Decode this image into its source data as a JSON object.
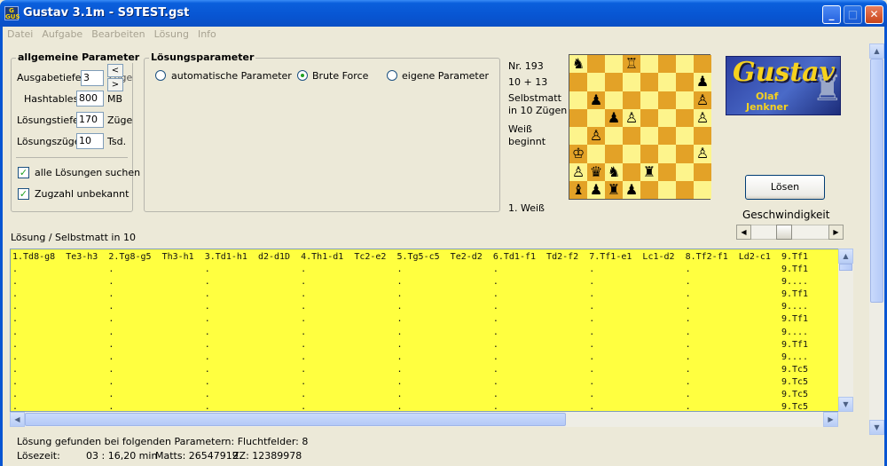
{
  "window": {
    "app_icon_text": "G\nGUS",
    "title": "Gustav 3.1m - S9TEST.gst",
    "minimize": "_",
    "maximize": "□",
    "close": "✕"
  },
  "menu": [
    "Datei",
    "Aufgabe",
    "Bearbeiten",
    "Lösung",
    "Info"
  ],
  "general_params": {
    "title": "allgemeine Parameter",
    "output_depth_label": "Ausgabetiefe",
    "output_depth_value": "3",
    "output_depth_unit": "Züge",
    "hashtables_label": "Hashtables",
    "hashtables_value": "800",
    "hashtables_unit": "MB",
    "solution_depth_label": "Lösungstiefe",
    "solution_depth_value": "170",
    "solution_depth_unit": "Züge",
    "solution_moves_label": "Lösungszüge",
    "solution_moves_value": "10",
    "solution_moves_unit": "Tsd.",
    "all_solutions_label": "alle Lösungen suchen",
    "all_solutions_checked": true,
    "count_unknown_label": "Zugzahl unbekannt",
    "count_unknown_checked": true,
    "spin_left": "<",
    "spin_right": ">"
  },
  "solution_params": {
    "title": "Lösungsparameter",
    "options": [
      {
        "label": "automatische Parameter",
        "selected": false
      },
      {
        "label": "Brute Force",
        "selected": true
      },
      {
        "label": "eigene Parameter",
        "selected": false
      }
    ]
  },
  "problem": {
    "number": "Nr. 193",
    "pieces": "10 + 13",
    "stipulation_line1": "Selbstmatt",
    "stipulation_line2": "in 10 Zügen",
    "to_move_line1": "Weiß",
    "to_move_line2": "beginnt",
    "current_move": "1. Weiß"
  },
  "board": [
    [
      "♞",
      "",
      "",
      "♖",
      "",
      "",
      "",
      ""
    ],
    [
      "",
      "",
      "",
      "",
      "",
      "",
      "",
      "♟"
    ],
    [
      "",
      "♟",
      "",
      "",
      "",
      "",
      "",
      "♙"
    ],
    [
      "",
      "",
      "♟",
      "♙",
      "",
      "",
      "",
      "♙"
    ],
    [
      "",
      "♙",
      "",
      "",
      "",
      "",
      "",
      ""
    ],
    [
      "♔",
      "",
      "",
      "",
      "",
      "",
      "",
      "♙"
    ],
    [
      "♙",
      "♛",
      "♞",
      "",
      "♜",
      "",
      "",
      ""
    ],
    [
      "♝",
      "♟",
      "♜",
      "♟",
      "",
      "",
      "",
      ""
    ],
    [
      "♛",
      "♕",
      "♚",
      "♖",
      "",
      "",
      "",
      ""
    ]
  ],
  "logo": {
    "title": "Gustav",
    "author_line1": "Olaf",
    "author_line2": "Jenkner",
    "castle_icon": "♜"
  },
  "solve_button": "Lösen",
  "speed_label": "Geschwindigkeit",
  "solution_caption": "Lösung / Selbstmatt in 10",
  "solution_lines": [
    "1.Td8-g8  Te3-h3  2.Tg8-g5  Th3-h1  3.Td1-h1  d2-d1D  4.Th1-d1  Tc2-e2  5.Tg5-c5  Te2-d2  6.Td1-f1  Td2-f2  7.Tf1-e1  Lc1-d2  8.Tf2-f1  Ld2-c1  9.Tf1",
    ".                 .                 .                 .                 .                 .                 .                 .                 9.Tf1",
    ".                 .                 .                 .                 .                 .                 .                 .                 9....",
    ".                 .                 .                 .                 .                 .                 .                 .                 9.Tf1",
    ".                 .                 .                 .                 .                 .                 .                 .                 9....",
    ".                 .                 .                 .                 .                 .                 .                 .                 9.Tf1",
    ".                 .                 .                 .                 .                 .                 .                 .                 9....",
    ".                 .                 .                 .                 .                 .                 .                 .                 9.Tf1",
    ".                 .                 .                 .                 .                 .                 .                 .                 9....",
    ".                 .                 .                 .                 .                 .                 .                 .                 9.Tc5",
    ".                 .                 .                 .                 .                 .                 .                 .                 9.Tc5",
    ".                 .                 .                 .                 .                 .                 .                 .                 9.Tc5",
    ".                 .                 .                 .                 .                 .                 .                 .                 9.Tc5"
  ],
  "status": {
    "params_line": "Lösung gefunden bei folgenden Parametern: Fluchtfelder: 8",
    "time_label": "Lösezeit:",
    "time_value": "03 : 16,20 min",
    "matts": "Matts: 26547919",
    "zz": "ZZ: 12389978"
  }
}
